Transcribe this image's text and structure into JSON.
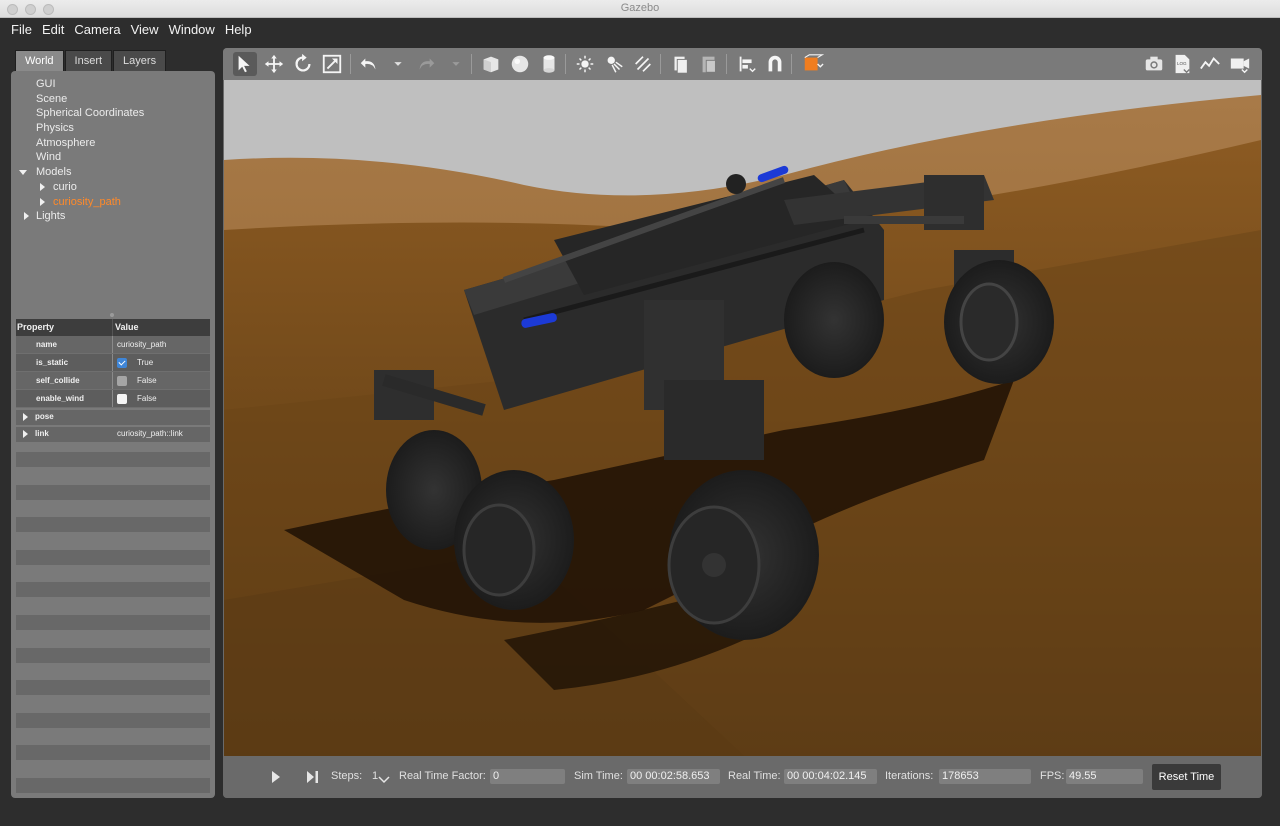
{
  "window": {
    "title": "Gazebo"
  },
  "menu": [
    "File",
    "Edit",
    "Camera",
    "View",
    "Window",
    "Help"
  ],
  "left_panel": {
    "tabs": [
      {
        "label": "World",
        "active": true
      },
      {
        "label": "Insert",
        "active": false
      },
      {
        "label": "Layers",
        "active": false
      }
    ],
    "tree": [
      {
        "label": "GUI",
        "indent": 0,
        "arrow": "none"
      },
      {
        "label": "Scene",
        "indent": 0,
        "arrow": "none"
      },
      {
        "label": "Spherical Coordinates",
        "indent": 0,
        "arrow": "none"
      },
      {
        "label": "Physics",
        "indent": 0,
        "arrow": "none"
      },
      {
        "label": "Atmosphere",
        "indent": 0,
        "arrow": "none"
      },
      {
        "label": "Wind",
        "indent": 0,
        "arrow": "none"
      },
      {
        "label": "Models",
        "indent": 0,
        "arrow": "down"
      },
      {
        "label": "curio",
        "indent": 1,
        "arrow": "right"
      },
      {
        "label": "curiosity_path",
        "indent": 1,
        "arrow": "right",
        "selected": true
      },
      {
        "label": "Lights",
        "indent": 0,
        "arrow": "right"
      }
    ],
    "properties": {
      "header": {
        "property": "Property",
        "value": "Value"
      },
      "rows": [
        {
          "name": "name",
          "value": "curiosity_path",
          "checkbox": "none"
        },
        {
          "name": "is_static",
          "value": "True",
          "checkbox": "on"
        },
        {
          "name": "self_collide",
          "value": "False",
          "checkbox": "grey"
        },
        {
          "name": "enable_wind",
          "value": "False",
          "checkbox": "white"
        }
      ],
      "expand_rows": [
        {
          "name": "pose",
          "value": ""
        },
        {
          "name": "link",
          "value": "curiosity_path::link"
        }
      ]
    }
  },
  "toolbar": {
    "tools": [
      "select-icon",
      "translate-icon",
      "rotate-icon",
      "scale-icon",
      "undo-icon",
      "undo-dropdown-icon",
      "redo-icon",
      "redo-dropdown-icon",
      "box-icon",
      "sphere-icon",
      "cylinder-icon",
      "point-light-icon",
      "spot-light-icon",
      "directional-light-icon",
      "copy-icon",
      "paste-icon",
      "align-icon",
      "snap-icon",
      "view-angle-icon",
      "screenshot-icon",
      "log-icon",
      "plot-icon",
      "video-record-icon"
    ],
    "active_tool": "select-icon",
    "accent": "#f07d1f"
  },
  "bottom_bar": {
    "steps_label": "Steps:",
    "steps_value": "1",
    "rtf_label": "Real Time Factor:",
    "rtf_value": "0",
    "sim_time_label": "Sim Time:",
    "sim_time_value": "00 00:02:58.653",
    "real_time_label": "Real Time:",
    "real_time_value": "00 00:04:02.145",
    "iterations_label": "Iterations:",
    "iterations_value": "178653",
    "fps_label": "FPS:",
    "fps_value": "49.55",
    "reset_label": "Reset Time"
  },
  "colors": {
    "sky": "#bdbdbd",
    "terrain": "#8a5a24",
    "rover": "#2a2a2a",
    "highlight_blue": "#1c3ad6",
    "selected_tree": "#ff8a2a"
  }
}
